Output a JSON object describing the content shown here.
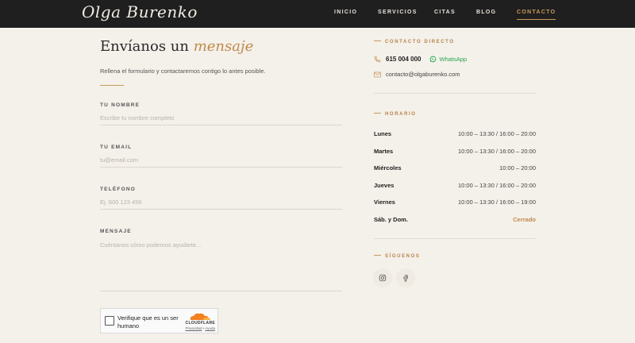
{
  "header": {
    "logo": "Olga Burenko",
    "nav": [
      {
        "label": "INICIO",
        "active": false
      },
      {
        "label": "SERVICIOS",
        "active": false
      },
      {
        "label": "CITAS",
        "active": false
      },
      {
        "label": "BLOG",
        "active": false
      },
      {
        "label": "CONTACTO",
        "active": true
      }
    ]
  },
  "form": {
    "title_main": "Envíanos un",
    "title_accent": "mensaje",
    "intro": "Rellena el formulario y contactaremos contigo lo antes posible.",
    "fields": [
      {
        "label": "TU NOMBRE",
        "placeholder": "Escribe tu nombre completo",
        "value": ""
      },
      {
        "label": "TU EMAIL",
        "placeholder": "tu@email.com",
        "value": ""
      },
      {
        "label": "TELÉFONO",
        "placeholder": "Ej. 600 123 456",
        "value": ""
      },
      {
        "label": "MENSAJE",
        "placeholder": "Cuéntanos cómo podemos ayudarte...",
        "value": ""
      }
    ],
    "captcha": {
      "text": "Verifique que es un ser humano",
      "brand": "CLOUDFLARE",
      "privacy": "Privacidad",
      "terms": "Ayuda"
    }
  },
  "contact": {
    "heading": "CONTACTO DIRECTO",
    "phone": "615 004 000",
    "whatsapp": "WhatsApp",
    "email": "contacto@olgaburenko.com"
  },
  "hours": {
    "heading": "HORARIO",
    "rows": [
      {
        "day": "Lunes",
        "time": "10:00 – 13:30 / 16:00 – 20:00",
        "closed": false
      },
      {
        "day": "Martes",
        "time": "10:00 – 13:30 / 16:00 – 20:00",
        "closed": false
      },
      {
        "day": "Miércoles",
        "time": "10:00 – 20:00",
        "closed": false
      },
      {
        "day": "Jueves",
        "time": "10:00 – 13:30 / 16:00 – 20:00",
        "closed": false
      },
      {
        "day": "Viernes",
        "time": "10:00 – 13:30 / 16:00 – 19:00",
        "closed": false
      },
      {
        "day": "Sáb. y Dom.",
        "time": "Cerrado",
        "closed": true
      }
    ]
  },
  "social": {
    "heading": "SÍGUENOS",
    "icons": [
      "instagram-icon",
      "facebook-icon"
    ]
  },
  "colors": {
    "accent": "#c89a5a",
    "header_bg": "#1f1f1f",
    "page_bg": "#f4f0ea",
    "whatsapp": "#25a84a"
  }
}
